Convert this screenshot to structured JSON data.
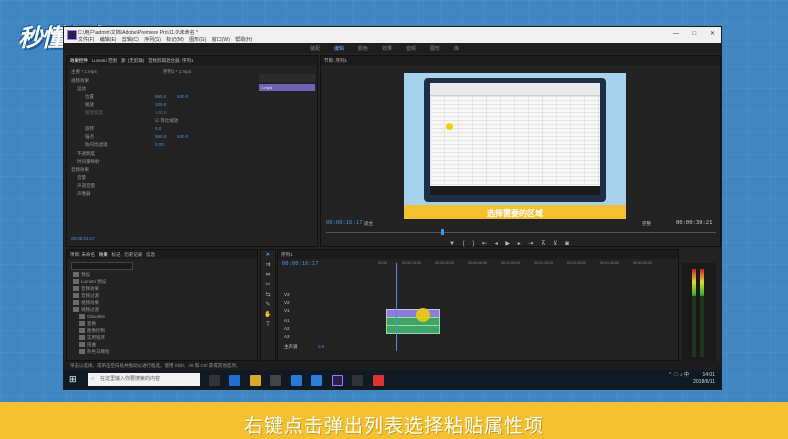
{
  "brand": {
    "logo_text": "秒懂视频"
  },
  "window": {
    "title": "C:\\用户\\admin\\文档\\Adobe\\Premiere Pro\\11.0\\未命名 *",
    "menu": [
      "文件(F)",
      "编辑(E)",
      "剪辑(C)",
      "序列(S)",
      "标记(M)",
      "图形(G)",
      "窗口(W)",
      "帮助(H)"
    ],
    "controls": [
      "—",
      "□",
      "✕"
    ]
  },
  "workspaces": {
    "items": [
      "装配",
      "编辑",
      "颜色",
      "效果",
      "音频",
      "图形",
      "库"
    ],
    "active": "编辑"
  },
  "effect_controls": {
    "tabs": [
      "效果控件",
      "Lumetri 范围",
      "源: (无剪辑)",
      "音频剪辑混合器: 序列1"
    ],
    "source_label": "主要 * 1.mp4",
    "sequence_label": "序列1 * 1.mp4",
    "sections": [
      "视频效果",
      "运动",
      "不透明度",
      "时间重映射",
      "音频效果",
      "音量",
      "声道音量",
      "声像器"
    ],
    "props": [
      {
        "name": "位置",
        "v1": "960.0",
        "v2": "540.0"
      },
      {
        "name": "缩放",
        "v1": "100.0",
        "v2": ""
      },
      {
        "name": "缩放宽度",
        "v1": "100.0",
        "v2": ""
      },
      {
        "name": "等比缩放",
        "v1": "",
        "v2": ""
      },
      {
        "name": "旋转",
        "v1": "0.0",
        "v2": ""
      },
      {
        "name": "锚点",
        "v1": "960.0",
        "v2": "540.0"
      },
      {
        "name": "防闪烁滤镜",
        "v1": "0.00",
        "v2": ""
      }
    ],
    "timecode": "00:00:16:17",
    "clip_label": "1.mp4"
  },
  "program_monitor": {
    "title": "节目: 序列1",
    "timecode_current": "00:00:16:17",
    "fit": "适合",
    "quality": "完整",
    "timecode_total": "00:00:39:21",
    "subtitle": "选择需要的区域"
  },
  "project": {
    "tabs": [
      "项目: 未命名",
      "效果",
      "标记",
      "历史记录",
      "信息"
    ],
    "folders": [
      "预设",
      "Lumetri 预设",
      "音频效果",
      "音频过渡",
      "视频效果",
      "视频过渡",
      "Obsolete",
      "变换",
      "图像控制",
      "实用程序",
      "扭曲",
      "杂色与颗粒",
      "模糊与锐化",
      "生成"
    ]
  },
  "timeline": {
    "tab": "序列1",
    "timecode": "00:00:16:17",
    "ruler": [
      "00:00",
      "00:00:15:00",
      "00:00:30:00",
      "00:00:45:00",
      "00:01:00:00",
      "00:01:15:00",
      "00:01:30:00",
      "00:01:45:00",
      "00:02:00:00"
    ],
    "video_tracks": [
      "V3",
      "V2",
      "V1"
    ],
    "audio_tracks": [
      "A1",
      "A2",
      "A3"
    ],
    "master": "主声道",
    "master_value": "0.0"
  },
  "status_bar": {
    "text": "单击以选择，或单击空白处并拖动以进行框选。使用 Shift、Alt 和 Ctrl 获得其他选项。"
  },
  "taskbar": {
    "search_placeholder": "在这里输入你要搜索的内容",
    "time": "14:01",
    "date": "2018/6/11"
  },
  "caption": {
    "text": "右键点击弹出列表选择粘贴属性项"
  },
  "colors": {
    "accent": "#4a90e2",
    "banner": "#f4c030",
    "background": "#3f86c2"
  }
}
